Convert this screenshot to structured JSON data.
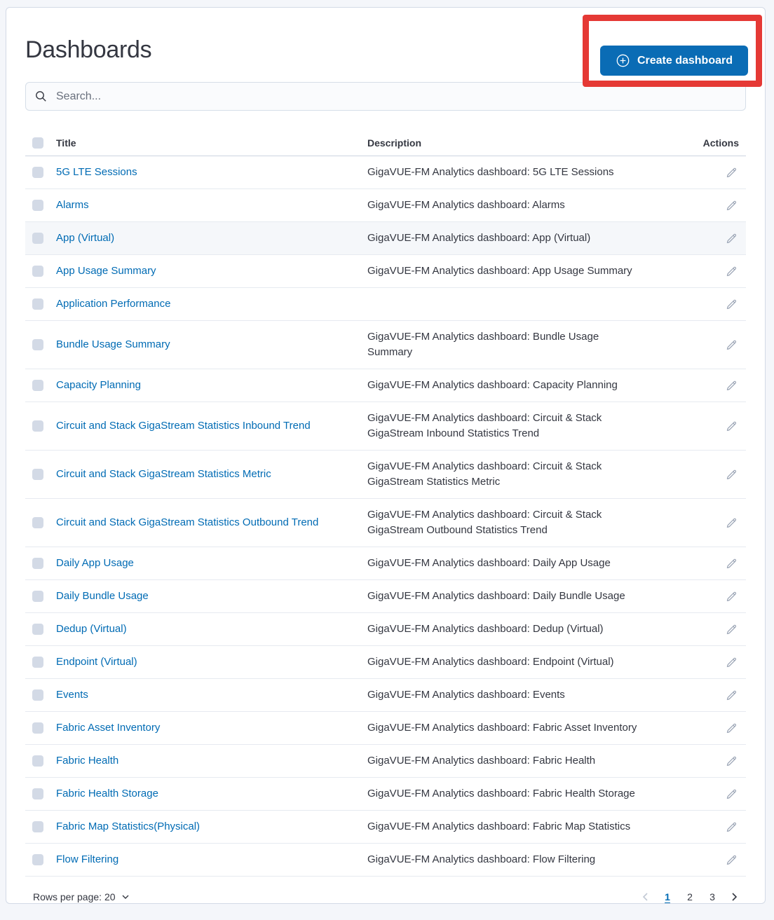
{
  "page": {
    "title": "Dashboards"
  },
  "create_button": {
    "label": "Create dashboard"
  },
  "search": {
    "placeholder": "Search..."
  },
  "table": {
    "columns": {
      "title": "Title",
      "description": "Description",
      "actions": "Actions"
    },
    "rows": [
      {
        "title": "5G LTE Sessions",
        "description": "GigaVUE-FM Analytics dashboard: 5G LTE Sessions",
        "highlighted": false
      },
      {
        "title": "Alarms",
        "description": "GigaVUE-FM Analytics dashboard: Alarms",
        "highlighted": false
      },
      {
        "title": "App (Virtual)",
        "description": "GigaVUE-FM Analytics dashboard: App (Virtual)",
        "highlighted": true
      },
      {
        "title": "App Usage Summary",
        "description": "GigaVUE-FM Analytics dashboard: App Usage Summary",
        "highlighted": false
      },
      {
        "title": "Application Performance",
        "description": "",
        "highlighted": false
      },
      {
        "title": "Bundle Usage Summary",
        "description": "GigaVUE-FM Analytics dashboard: Bundle Usage\nSummary",
        "highlighted": false
      },
      {
        "title": "Capacity Planning",
        "description": "GigaVUE-FM Analytics dashboard: Capacity Planning",
        "highlighted": false
      },
      {
        "title": "Circuit and Stack GigaStream Statistics Inbound Trend",
        "description": "GigaVUE-FM Analytics dashboard: Circuit & Stack\nGigaStream Inbound Statistics Trend",
        "highlighted": false
      },
      {
        "title": "Circuit and Stack GigaStream Statistics Metric",
        "description": "GigaVUE-FM Analytics dashboard: Circuit & Stack\nGigaStream Statistics Metric",
        "highlighted": false
      },
      {
        "title": "Circuit and Stack GigaStream Statistics Outbound Trend",
        "description": "GigaVUE-FM Analytics dashboard: Circuit & Stack\nGigaStream Outbound Statistics Trend",
        "highlighted": false
      },
      {
        "title": "Daily App Usage",
        "description": "GigaVUE-FM Analytics dashboard: Daily App Usage",
        "highlighted": false
      },
      {
        "title": "Daily Bundle Usage",
        "description": "GigaVUE-FM Analytics dashboard: Daily Bundle Usage",
        "highlighted": false
      },
      {
        "title": "Dedup (Virtual)",
        "description": "GigaVUE-FM Analytics dashboard: Dedup (Virtual)",
        "highlighted": false
      },
      {
        "title": "Endpoint (Virtual)",
        "description": "GigaVUE-FM Analytics dashboard: Endpoint (Virtual)",
        "highlighted": false
      },
      {
        "title": "Events",
        "description": "GigaVUE-FM Analytics dashboard: Events",
        "highlighted": false
      },
      {
        "title": "Fabric Asset Inventory",
        "description": "GigaVUE-FM Analytics dashboard: Fabric Asset Inventory",
        "highlighted": false
      },
      {
        "title": "Fabric Health",
        "description": "GigaVUE-FM Analytics dashboard: Fabric Health",
        "highlighted": false
      },
      {
        "title": "Fabric Health Storage",
        "description": "GigaVUE-FM Analytics dashboard: Fabric Health Storage",
        "highlighted": false
      },
      {
        "title": "Fabric Map Statistics(Physical)",
        "description": "GigaVUE-FM Analytics dashboard: Fabric Map Statistics",
        "highlighted": false
      },
      {
        "title": "Flow Filtering",
        "description": "GigaVUE-FM Analytics dashboard: Flow Filtering",
        "highlighted": false
      }
    ]
  },
  "pagination": {
    "rows_per_page_label": "Rows per page: 20",
    "pages": [
      "1",
      "2",
      "3"
    ],
    "active_page": "1"
  },
  "icons": {
    "create": "plus-circle-icon",
    "search": "search-icon",
    "edit": "pencil-icon",
    "rows_per_page": "chevron-down-icon",
    "prev": "chevron-left-icon",
    "next": "chevron-right-icon"
  },
  "colors": {
    "link_blue": "#006bb4",
    "button_blue": "#0a6cb5",
    "highlight_red": "#e53935",
    "text": "#343741",
    "row_stripe": "#f5f7fa",
    "checkbox": "#d3dae6",
    "icon_gray": "#98a2b3"
  }
}
